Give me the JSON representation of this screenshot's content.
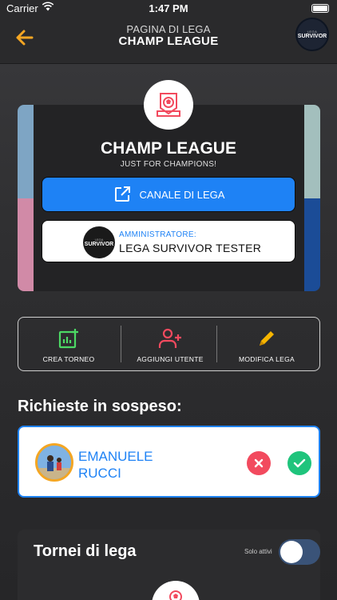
{
  "status_bar": {
    "carrier": "Carrier",
    "time": "1:47 PM"
  },
  "header": {
    "subtitle": "PAGINA DI LEGA",
    "title": "CHAMP LEAGUE",
    "logo_line1": "LEGA",
    "logo_line2": "SURVIVOR"
  },
  "league": {
    "name": "CHAMP LEAGUE",
    "motto": "JUST FOR CHAMPIONS!",
    "channel_label": "CANALE DI LEGA",
    "admin_label": "AMMINISTRATORE:",
    "admin_name": "LEGA SURVIVOR TESTER",
    "admin_logo_line1": "LEGA",
    "admin_logo_line2": "SURVIVOR",
    "stripe_colors": [
      "#7ea5c4",
      "#d18aa7",
      "#a3bfbd",
      "#1b4c97"
    ]
  },
  "actions": {
    "create_tournament": "CREA TORNEO",
    "add_user": "AGGIUNGI UTENTE",
    "edit_league": "MODIFICA LEGA"
  },
  "pending": {
    "title": "Richieste in sospeso:",
    "requests": [
      {
        "name_line1": "EMANUELE",
        "name_line2": "RUCCI"
      }
    ]
  },
  "tournaments": {
    "title": "Tornei di lega",
    "only_active_label": "Solo attivi",
    "only_active_on": false
  },
  "colors": {
    "accent": "#1e82f5",
    "back_arrow": "#f5a623",
    "create": "#4cd964",
    "add_user": "#f24a5e",
    "edit": "#f7b500",
    "reject": "#f24a5e",
    "accept": "#1fc47c"
  }
}
